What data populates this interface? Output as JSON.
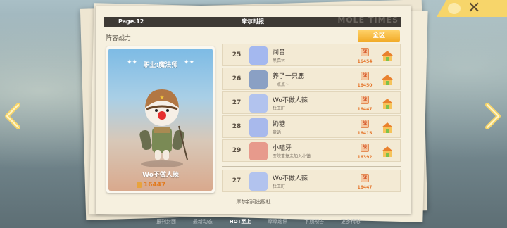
{
  "header": {
    "page": "Page.12",
    "title": "摩尔时报",
    "brand": "MOLE TIMES"
  },
  "section_label": "阵容战力",
  "region_button": "全区",
  "card": {
    "job": "职业:魔法师",
    "name": "Wo不做人辣",
    "power": "16447"
  },
  "rows": [
    {
      "rank": "25",
      "name": "闻音",
      "sub": "黑森林",
      "power": "16454",
      "avatar_color": "#a4b8ef"
    },
    {
      "rank": "26",
      "name": "养了一只鹿",
      "sub": "一点点丶",
      "power": "16450",
      "avatar_color": "#8aa0c4"
    },
    {
      "rank": "27",
      "name": "Wo不做人辣",
      "sub": "杜王町",
      "power": "16447",
      "avatar_color": "#b2c3ee"
    },
    {
      "rank": "28",
      "name": "奶糖",
      "sub": "童话",
      "power": "16415",
      "avatar_color": "#a8b9ec"
    },
    {
      "rank": "29",
      "name": "小喵牙",
      "sub": "医院重复未加入小镇",
      "power": "16392",
      "avatar_color": "#e79a8c"
    }
  ],
  "my_row": {
    "rank": "27",
    "name": "Wo不做人辣",
    "sub": "杜王町",
    "power": "16447",
    "avatar_color": "#b2c3ee"
  },
  "power_icon_label": "战",
  "publisher": "摩尔新闻出版社",
  "bottom_tabs": [
    "报刊封面",
    "最新动态",
    "HOT至上",
    "摩摩趣讯",
    "下期预告",
    "更多精彩"
  ],
  "active_tab": "HOT至上",
  "colors": {
    "accent": "#f1a925",
    "power": "#e5782e",
    "header_bg": "#3e3a35",
    "paper": "#f6f0df"
  },
  "icons": {
    "close": "close-icon",
    "left_arrow": "chevron-left-icon",
    "right_arrow": "chevron-right-icon",
    "home": "home-icon",
    "power": "power-badge-icon"
  }
}
